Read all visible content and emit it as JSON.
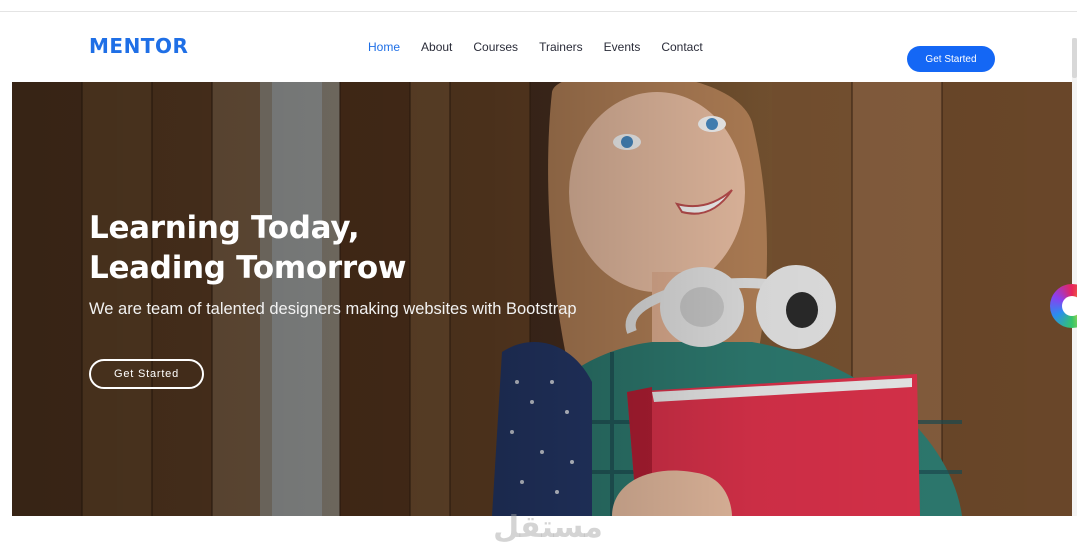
{
  "header": {
    "logo": "MENTOR",
    "nav": [
      "Home",
      "About",
      "Courses",
      "Trainers",
      "Events",
      "Contact"
    ],
    "active_nav": "Home",
    "cta_label": "Get Started"
  },
  "hero": {
    "title_line1": "Learning Today,",
    "title_line2": "Leading Tomorrow",
    "subtitle": "We are team of talented designers making websites with Bootstrap",
    "button_label": "Get Started"
  },
  "watermark": "مستقل",
  "colors": {
    "brand": "#1f6fe6",
    "cta": "#1467f5",
    "nav_text": "#2a2c39"
  }
}
